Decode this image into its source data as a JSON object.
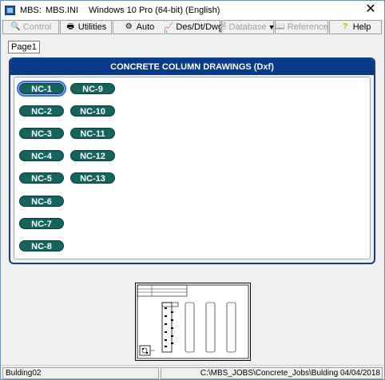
{
  "titlebar": {
    "app": "MBS:",
    "ini": "MBS.INI",
    "os": "Windows 10 Pro (64-bit) (English)",
    "close": "✕"
  },
  "toolbar": {
    "control": "Control",
    "utilities": "Utilities",
    "auto": "Auto",
    "desdtdwg": "Des/Dt/Dwg",
    "database": "Database",
    "reference": "Reference",
    "help": "Help"
  },
  "tabs": {
    "page1": "Page1"
  },
  "panel": {
    "title": "CONCRETE COLUMN DRAWINGS (Dxf)",
    "buttons": [
      "NC-1",
      "NC-2",
      "NC-3",
      "NC-4",
      "NC-5",
      "NC-6",
      "NC-7",
      "NC-8",
      "NC-9",
      "NC-10",
      "NC-11",
      "NC-12",
      "NC-13"
    ],
    "selected": "NC-1"
  },
  "status": {
    "job": "Bulding02",
    "path": "C:\\MBS_JOBS\\Concrete_Jobs\\Bulding 04/04/2018"
  },
  "colors": {
    "header": "#063b8c",
    "button": "#12655f"
  }
}
